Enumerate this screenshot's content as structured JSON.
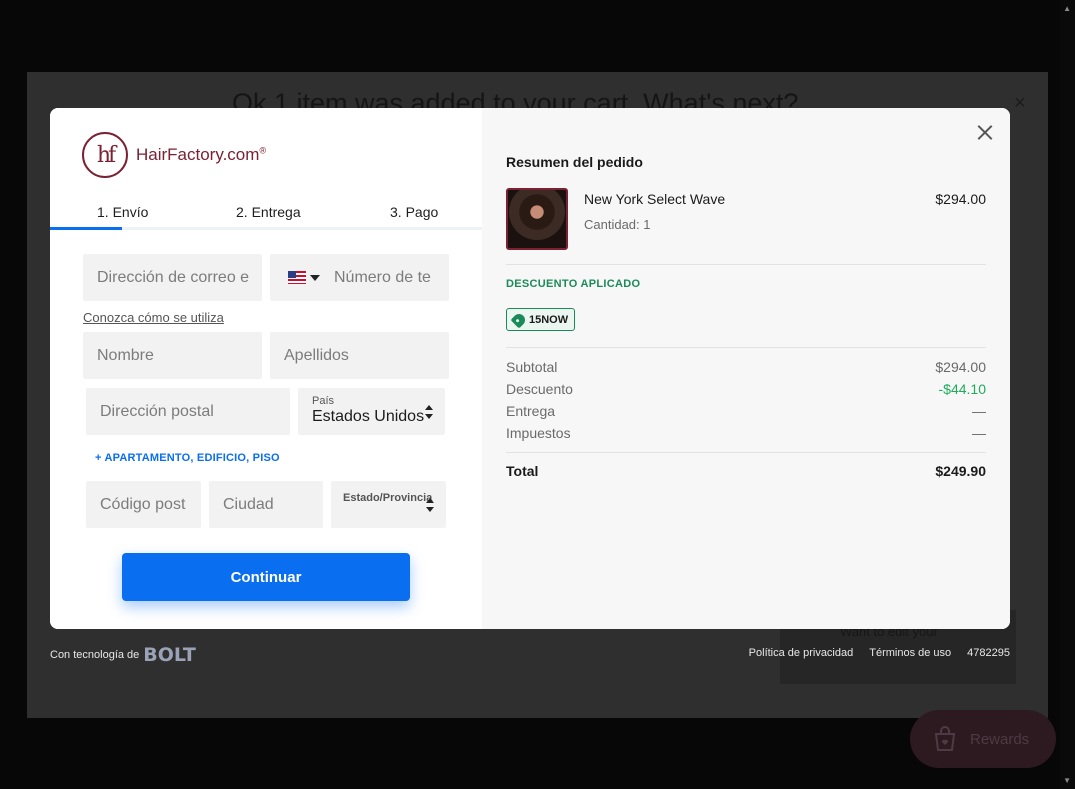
{
  "background": {
    "heading": "Ok 1 item was added to your cart. What's next?",
    "close_glyph": "×",
    "edit_cart": "Want to edit your",
    "rewards_label": "Rewards"
  },
  "brand": {
    "logo_mark": "hf",
    "name": "HairFactory.com",
    "trademark": "®"
  },
  "tabs": [
    {
      "label": "1. Envío",
      "active": true
    },
    {
      "label": "2. Entrega",
      "active": false
    },
    {
      "label": "3. Pago",
      "active": false
    }
  ],
  "form": {
    "email_placeholder": "Dirección de correo e",
    "phone_placeholder": "Número de te",
    "learn_link": "Conozca cómo se utiliza",
    "first_name_placeholder": "Nombre",
    "last_name_placeholder": "Apellidos",
    "address_placeholder": "Dirección postal",
    "country_label": "País",
    "country_value": "Estados Unidos",
    "apartment_link": "+ APARTAMENTO, EDIFICIO, PISO",
    "postal_placeholder": "Código post",
    "city_placeholder": "Ciudad",
    "state_label": "Estado/Provincia",
    "continue_label": "Continuar"
  },
  "summary": {
    "title": "Resumen del pedido",
    "product": {
      "name": "New York Select Wave",
      "quantity": "Cantidad: 1",
      "price": "$294.00"
    },
    "discount_title": "DESCUENTO APLICADO",
    "discount_code": "15NOW",
    "lines": [
      {
        "label": "Subtotal",
        "value": "$294.00"
      },
      {
        "label": "Descuento",
        "value": "-$44.10"
      },
      {
        "label": "Entrega",
        "value": "—"
      },
      {
        "label": "Impuestos",
        "value": "—"
      }
    ],
    "total_label": "Total",
    "total_value": "$249.90"
  },
  "footer": {
    "powered_by": "Con tecnología de",
    "bolt": "BOLT",
    "privacy": "Política de privacidad",
    "terms": "Términos de uso",
    "id": "4782295"
  },
  "colors": {
    "accent": "#0a6ef0",
    "brand": "#7a2133",
    "discount_green": "#1b8a5a"
  }
}
